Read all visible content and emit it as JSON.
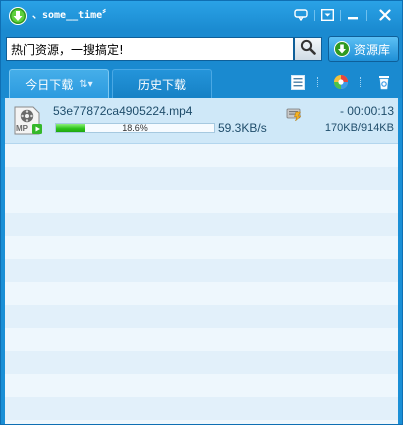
{
  "window": {
    "title": "、some__time〞",
    "colors": {
      "frame": "#1a8fd6",
      "list_row_even": "#eef7fd",
      "list_row_odd": "#e2f0fa",
      "selected_row": "#cfe8f8",
      "progress_green": "#2fc51c"
    },
    "icons": {
      "app_logo": "download-arrow-icon",
      "title_buttons": [
        "skin-icon",
        "menu-icon",
        "minimize-icon",
        "close-icon"
      ]
    }
  },
  "search": {
    "value": "热门资源，一搜搞定!",
    "button_icon": "search-icon",
    "resource_button_label": "资源库",
    "resource_button_icon": "download-arrow-icon"
  },
  "tabs": [
    {
      "label": "今日下载",
      "active": true,
      "icon": "sort-icon"
    },
    {
      "label": "历史下载",
      "active": false
    }
  ],
  "toolbar": {
    "icons": [
      "list-view-icon",
      "color-ball-icon",
      "recycle-bin-icon"
    ]
  },
  "downloads": [
    {
      "file_name": "53e77872ca4905224.mp4",
      "file_type_label": "MP",
      "progress_label": "18.6%",
      "progress": 0.186,
      "speed": "59.3KB/s",
      "time_remaining": "- 00:00:13",
      "size": "170KB/914KB",
      "file_icon": "video-file-icon",
      "priority_icon": "speed-boost-icon"
    }
  ]
}
